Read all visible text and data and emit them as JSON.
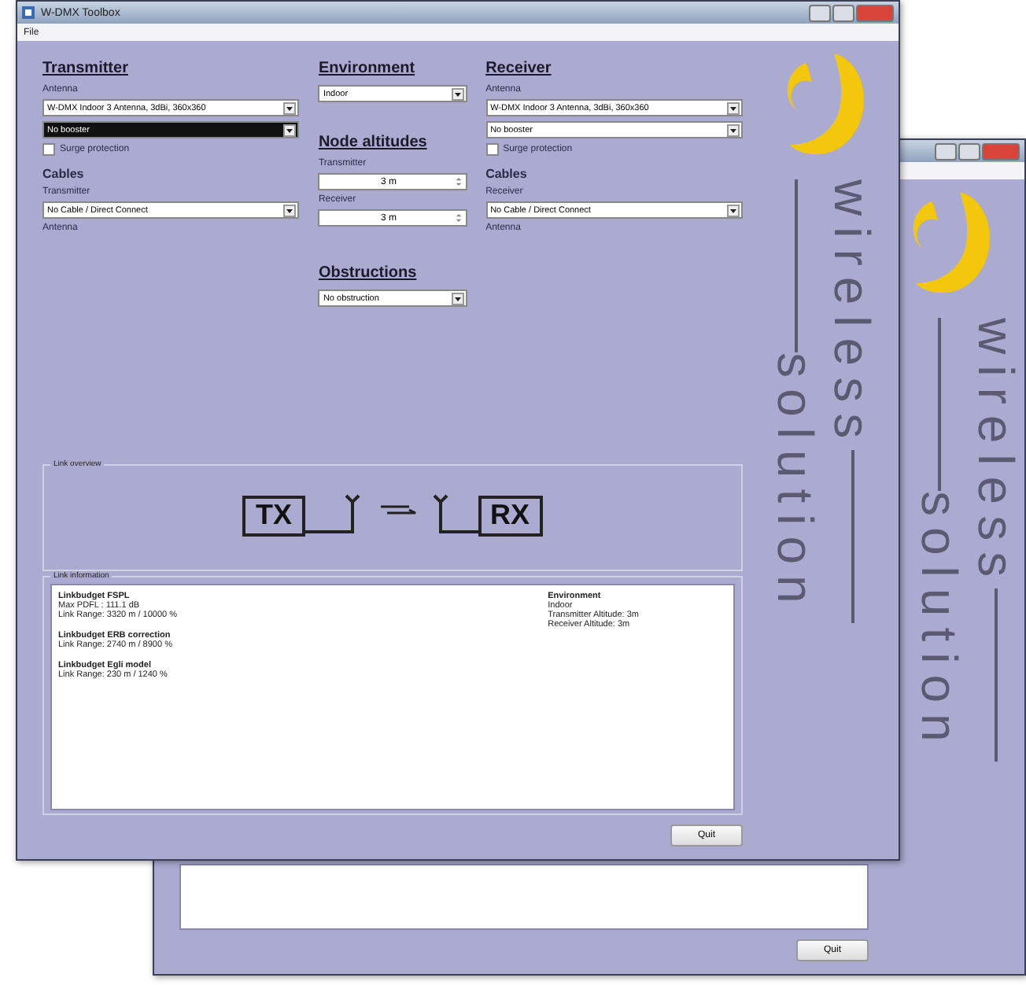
{
  "windows": [
    {
      "kind": "back",
      "logo": {
        "top": "wireless",
        "bottom": "solution"
      },
      "quit": "Quit"
    },
    {
      "kind": "main",
      "title": "W-DMX Toolbox",
      "menu": [
        "File"
      ],
      "transmitter": {
        "heading": "Transmitter",
        "antenna_label": "Antenna",
        "antenna": {
          "value": "W-DMX Indoor 3 Antenna, 3dBi, 360x360",
          "highlighted": false
        },
        "booster": {
          "value": "No booster",
          "highlighted": true
        },
        "surge": {
          "label": "Surge protection",
          "checked": false
        },
        "cables_heading": "Cables",
        "cable_label": "Transmitter",
        "cable": {
          "value": "No Cable / Direct Connect",
          "highlighted": false
        },
        "cable_end": "Antenna"
      },
      "environment": {
        "heading": "Environment",
        "value": "Indoor",
        "altitudes_heading": "Node altitudes",
        "altitudes": [
          {
            "label": "Transmitter",
            "value": "3 m"
          },
          {
            "label": "Receiver",
            "value": "3 m"
          }
        ],
        "obstructions_heading": "Obstructions",
        "obstruction": "No obstruction"
      },
      "receiver": {
        "heading": "Receiver",
        "antenna_label": "Antenna",
        "antenna": {
          "value": "W-DMX Indoor 3 Antenna, 3dBi, 360x360",
          "highlighted": false
        },
        "booster": {
          "value": "No booster",
          "highlighted": false
        },
        "surge": {
          "label": "Surge protection",
          "checked": false
        },
        "cables_heading": "Cables",
        "cable_label": "Receiver",
        "cable": {
          "value": "No Cable / Direct Connect",
          "highlighted": false
        },
        "cable_end": "Antenna"
      },
      "link_overview": {
        "title": "Link overview",
        "tx": "TX",
        "rx": "RX"
      },
      "link_information": {
        "title": "Link information",
        "left": [
          {
            "heading": "Linkbudget FSPL",
            "lines": [
              "Max PDFL : 111.1 dB",
              "Link Range: 3320 m / 10000 %"
            ]
          },
          {
            "heading": "Linkbudget ERB correction",
            "lines": [
              "Link Range: 2740 m / 8900 %"
            ]
          },
          {
            "heading": "Linkbudget Egli model",
            "lines": [
              "Link Range: 230 m / 1240 %"
            ]
          }
        ],
        "right": [
          {
            "heading": "Environment",
            "lines": [
              "Indoor",
              "Transmitter Altitude: 3m",
              "Receiver Altitude: 3m"
            ]
          }
        ]
      },
      "logo": {
        "top": "wireless",
        "bottom": "solution"
      },
      "quit": "Quit"
    }
  ]
}
